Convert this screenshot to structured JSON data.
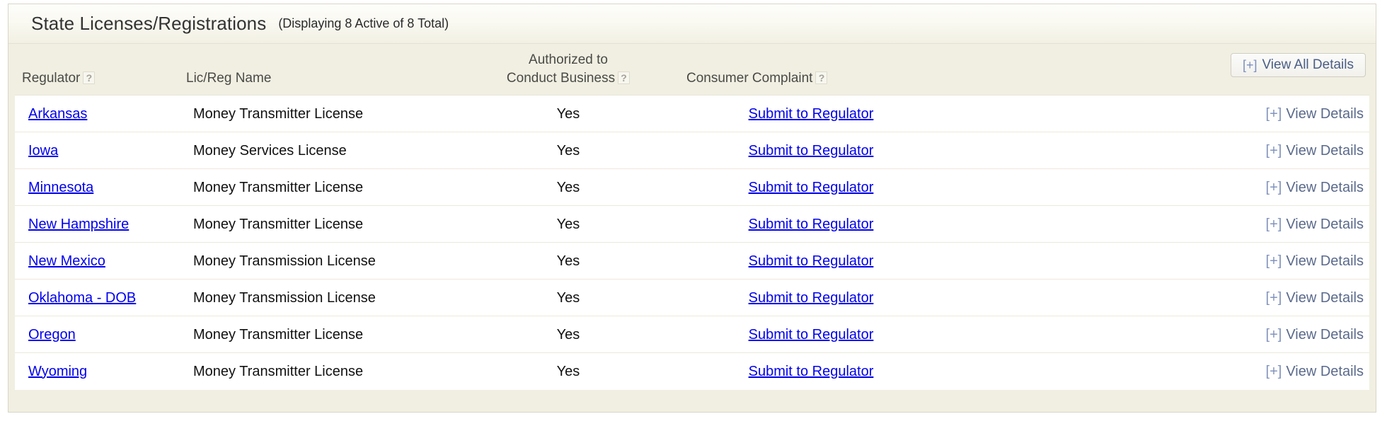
{
  "panel": {
    "title": "State Licenses/Registrations",
    "subtitle": "(Displaying 8 Active of 8 Total)"
  },
  "toolbar": {
    "view_all_details_label": "View All Details",
    "plus_glyph": "[+]"
  },
  "columns": {
    "regulator": "Regulator",
    "lic_reg_name": "Lic/Reg Name",
    "authorized_line1": "Authorized to",
    "authorized_line2": "Conduct Business",
    "consumer_complaint": "Consumer Complaint",
    "help_glyph": "?"
  },
  "row_action": {
    "plus_glyph": "[+]",
    "view_details_label": "View Details",
    "submit_label": "Submit to Regulator"
  },
  "colors": {
    "link": "#0000ee",
    "panel_background": "#f1efe2",
    "panel_border": "#d8d6c8",
    "button_text": "#4a5d86",
    "details_text": "#5a6a8c"
  },
  "rows": [
    {
      "regulator": "Arkansas",
      "lic_reg_name": "Money Transmitter License",
      "authorized": "Yes",
      "consumer_complaint": "Submit to Regulator",
      "details": "View Details"
    },
    {
      "regulator": "Iowa",
      "lic_reg_name": "Money Services License",
      "authorized": "Yes",
      "consumer_complaint": "Submit to Regulator",
      "details": "View Details"
    },
    {
      "regulator": "Minnesota",
      "lic_reg_name": "Money Transmitter License",
      "authorized": "Yes",
      "consumer_complaint": "Submit to Regulator",
      "details": "View Details"
    },
    {
      "regulator": "New Hampshire",
      "lic_reg_name": "Money Transmitter License",
      "authorized": "Yes",
      "consumer_complaint": "Submit to Regulator",
      "details": "View Details"
    },
    {
      "regulator": "New Mexico",
      "lic_reg_name": "Money Transmission License",
      "authorized": "Yes",
      "consumer_complaint": "Submit to Regulator",
      "details": "View Details"
    },
    {
      "regulator": "Oklahoma - DOB",
      "lic_reg_name": "Money Transmission License",
      "authorized": "Yes",
      "consumer_complaint": "Submit to Regulator",
      "details": "View Details"
    },
    {
      "regulator": "Oregon",
      "lic_reg_name": "Money Transmitter License",
      "authorized": "Yes",
      "consumer_complaint": "Submit to Regulator",
      "details": "View Details"
    },
    {
      "regulator": "Wyoming",
      "lic_reg_name": "Money Transmitter License",
      "authorized": "Yes",
      "consumer_complaint": "Submit to Regulator",
      "details": "View Details"
    }
  ]
}
